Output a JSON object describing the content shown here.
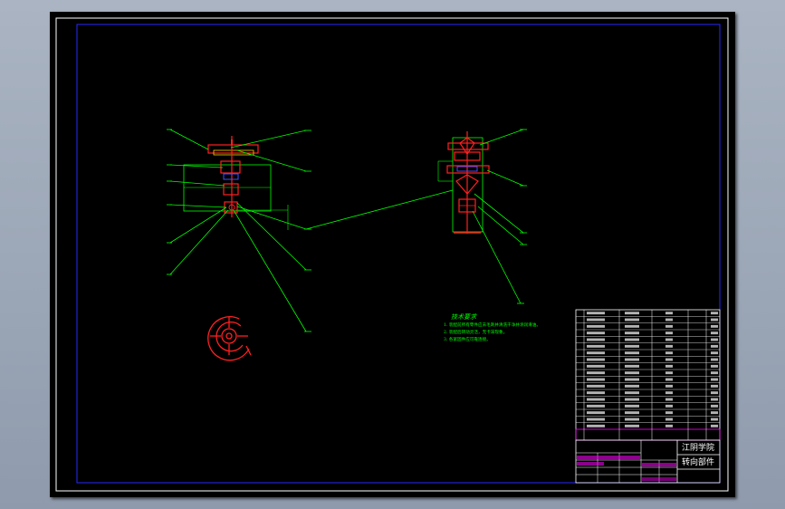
{
  "colors": {
    "background": "#000000",
    "frame": "#ffffff",
    "border": "#2828ff",
    "leader": "#00ff00",
    "part": "#ff2020",
    "note": "#00ff00",
    "title_text": "#ffffff",
    "title_magenta": "#ff00ff"
  },
  "tech_notes": {
    "title": "技术要求",
    "lines": [
      "1. 装配前所有零件应去毛刺并清洗干净并涂润滑油。",
      "2. 装配后转动灵活，无卡滞现象。",
      "3. 各紧固件应可靠连接。"
    ]
  },
  "title_block": {
    "school": "江阴学院",
    "drawing_name": "转向部件"
  }
}
